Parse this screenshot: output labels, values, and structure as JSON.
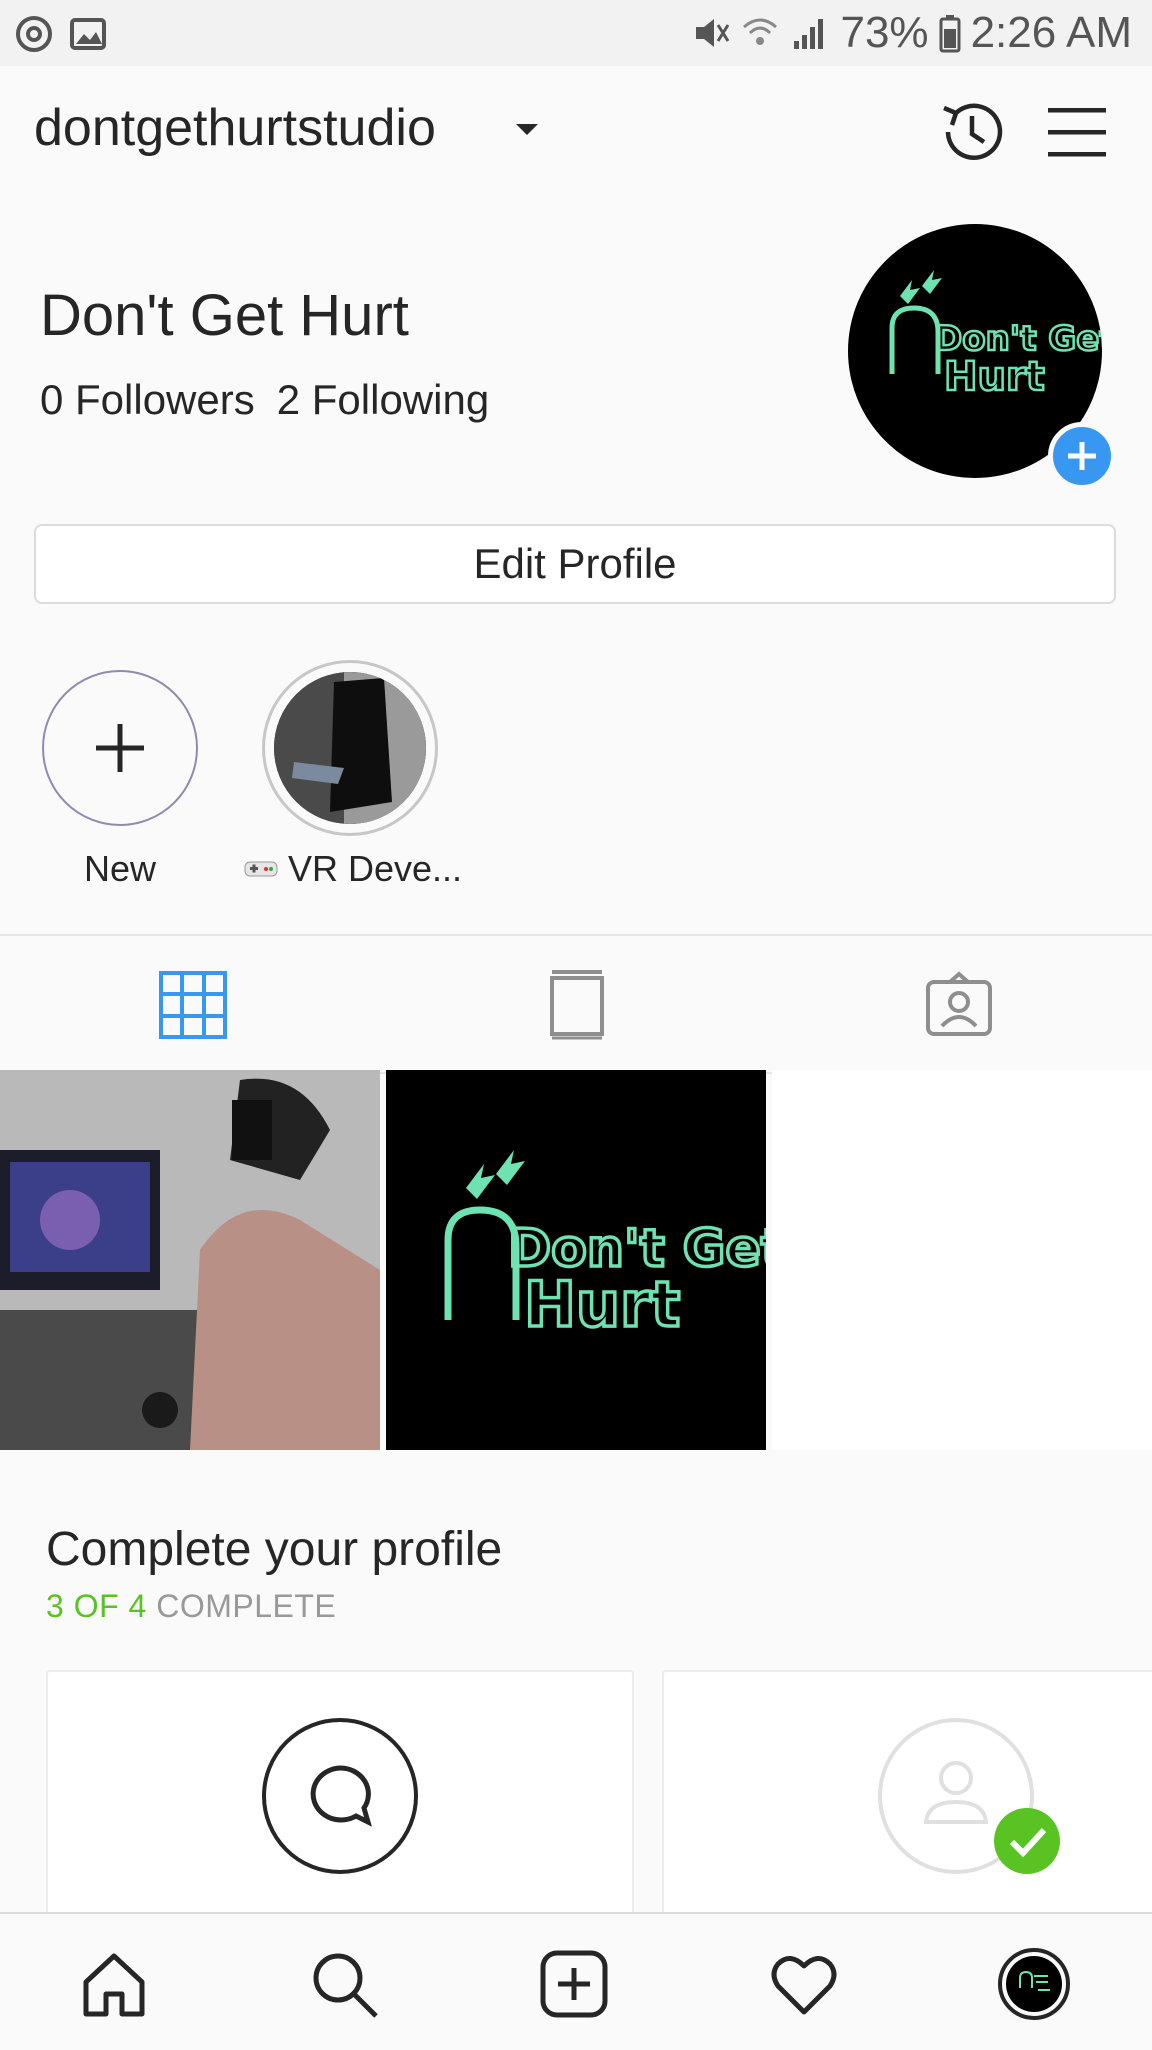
{
  "status_bar": {
    "battery": "73%",
    "time": "2:26 AM"
  },
  "header": {
    "username": "dontgethurtstudio"
  },
  "profile": {
    "display_name": "Don't Get Hurt",
    "followers": "0 Followers",
    "following": "2 Following",
    "edit_button": "Edit Profile",
    "avatar_logo_line1": "Don't Get",
    "avatar_logo_line2": "Hurt"
  },
  "highlights": [
    {
      "label": "New"
    },
    {
      "label": "VR Deve..."
    }
  ],
  "posts": [
    {
      "caption": ""
    },
    {
      "logo_line1": "Don't Get",
      "logo_line2": "Hurt"
    }
  ],
  "complete_profile": {
    "title": "Complete your profile",
    "progress_done": "3 OF 4",
    "progress_rest": " COMPLETE"
  },
  "colors": {
    "accent": "#3897f0",
    "logo_green": "#6ee2b0",
    "complete_green": "#58c322"
  }
}
